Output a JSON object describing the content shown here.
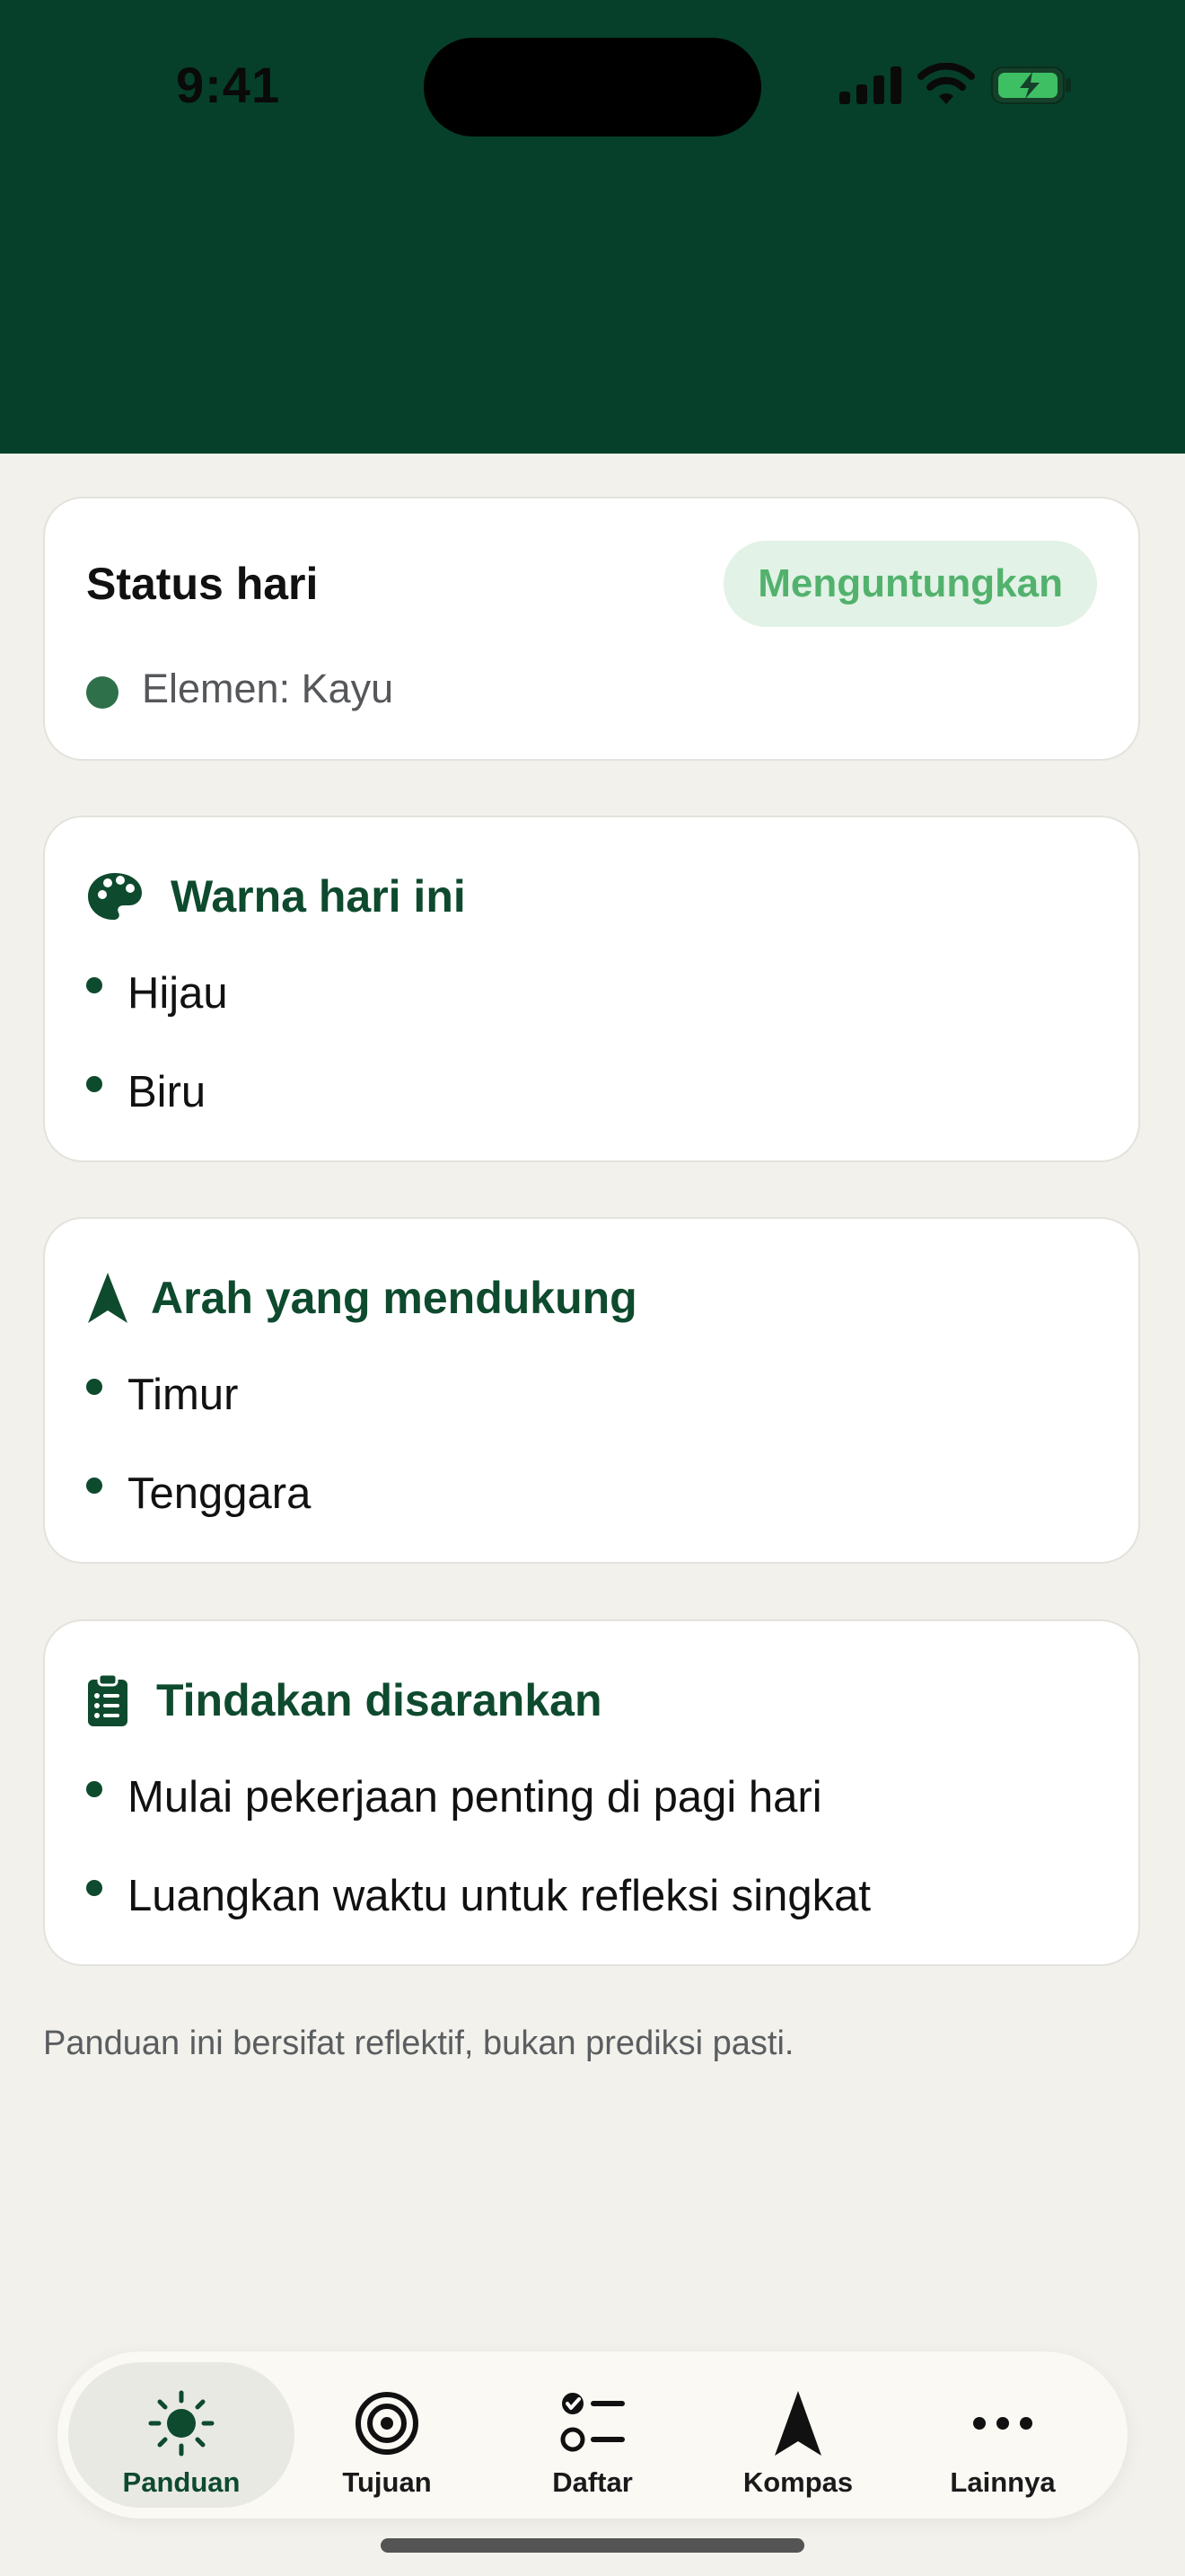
{
  "status_bar": {
    "time": "9:41"
  },
  "status_card": {
    "title": "Status hari",
    "badge": "Menguntungkan",
    "element": "Elemen: Kayu"
  },
  "colors_card": {
    "icon": "palette-icon",
    "title": "Warna hari ini",
    "items": [
      "Hijau",
      "Biru"
    ]
  },
  "direction_card": {
    "icon": "navigation-arrow-icon",
    "title": "Arah yang mendukung",
    "items": [
      "Timur",
      "Tenggara"
    ]
  },
  "actions_card": {
    "icon": "clipboard-list-icon",
    "title": "Tindakan disarankan",
    "items": [
      "Mulai pekerjaan penting di pagi hari",
      "Luangkan waktu untuk refleksi singkat"
    ]
  },
  "disclaimer": "Panduan ini bersifat reflektif, bukan prediksi pasti.",
  "tabs": [
    {
      "label": "Panduan",
      "icon": "sun-icon",
      "active": true
    },
    {
      "label": "Tujuan",
      "icon": "target-icon",
      "active": false
    },
    {
      "label": "Daftar",
      "icon": "checklist-icon",
      "active": false
    },
    {
      "label": "Kompas",
      "icon": "compass-arrow-icon",
      "active": false
    },
    {
      "label": "Lainnya",
      "icon": "more-dots-icon",
      "active": false
    }
  ],
  "theme": {
    "header_bg": "#06402A",
    "accent": "#0E4A2E",
    "badge_bg": "#E2F2E6",
    "badge_text": "#52B26D",
    "page_bg": "#F2F1EC"
  }
}
